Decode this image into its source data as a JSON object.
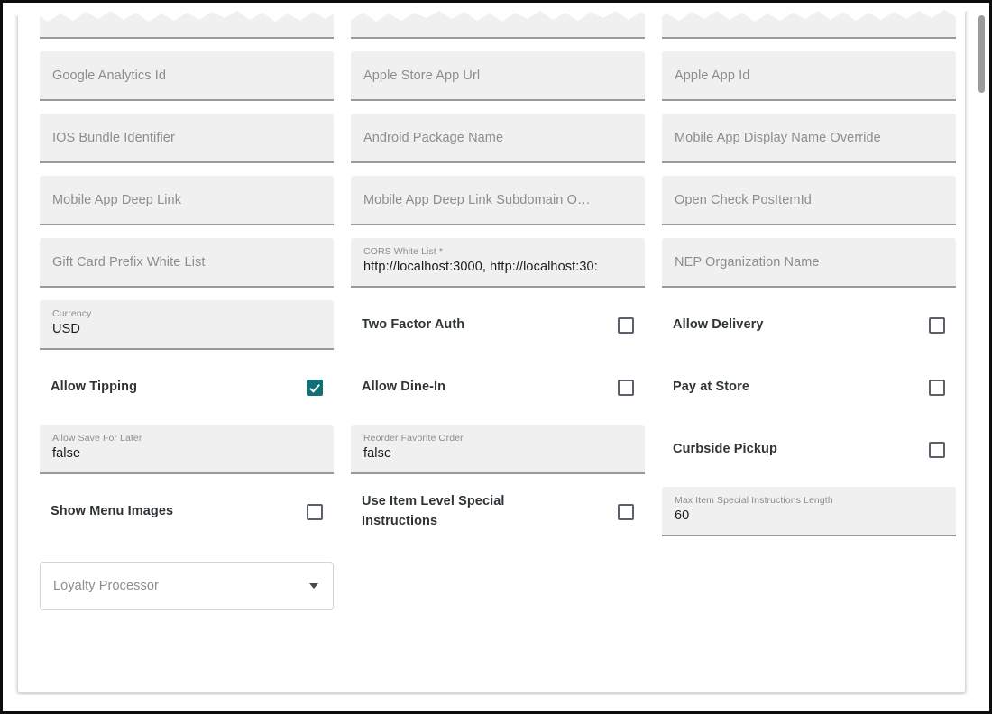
{
  "form": {
    "rows": [
      {
        "id": "row-clipped",
        "clipped": true,
        "cells": [
          {
            "type": "text-clipped",
            "name": "clipped-field-left",
            "placeholder": ""
          },
          {
            "type": "text-clipped",
            "name": "clipped-field-middle",
            "placeholder": ""
          },
          {
            "type": "text-clipped",
            "name": "clipped-field-right",
            "placeholder": ""
          }
        ]
      },
      {
        "id": "row-1",
        "cells": [
          {
            "type": "text",
            "name": "google-analytics-id-field",
            "placeholder": "Google Analytics Id",
            "value": ""
          },
          {
            "type": "text",
            "name": "apple-store-app-url-field",
            "placeholder": "Apple Store App Url",
            "value": ""
          },
          {
            "type": "text",
            "name": "apple-app-id-field",
            "placeholder": "Apple App Id",
            "value": ""
          }
        ]
      },
      {
        "id": "row-2",
        "cells": [
          {
            "type": "text",
            "name": "ios-bundle-identifier-field",
            "placeholder": "IOS Bundle Identifier",
            "value": ""
          },
          {
            "type": "text",
            "name": "android-package-name-field",
            "placeholder": "Android Package Name",
            "value": ""
          },
          {
            "type": "text",
            "name": "mobile-app-display-name-override-field",
            "placeholder": "Mobile App Display Name Override",
            "value": ""
          }
        ]
      },
      {
        "id": "row-3",
        "cells": [
          {
            "type": "text",
            "name": "mobile-app-deep-link-field",
            "placeholder": "Mobile App Deep Link",
            "value": ""
          },
          {
            "type": "text",
            "name": "mobile-app-deep-link-subdomain-override-field",
            "placeholder": "Mobile App Deep Link Subdomain O…",
            "value": ""
          },
          {
            "type": "text",
            "name": "open-check-positemid-field",
            "placeholder": "Open Check PosItemId",
            "value": ""
          }
        ]
      },
      {
        "id": "row-4",
        "cells": [
          {
            "type": "text",
            "name": "gift-card-prefix-white-list-field",
            "placeholder": "Gift Card Prefix White List",
            "value": ""
          },
          {
            "type": "filled",
            "name": "cors-white-list-field",
            "label": "CORS White List *",
            "value": "http://localhost:3000, http://localhost:30:"
          },
          {
            "type": "text",
            "name": "nep-organization-name-field",
            "placeholder": "NEP Organization Name",
            "value": ""
          }
        ]
      },
      {
        "id": "row-5",
        "cells": [
          {
            "type": "filled",
            "name": "currency-field",
            "label": "Currency",
            "value": "USD"
          },
          {
            "type": "checkbox",
            "name": "two-factor-auth-checkbox",
            "label": "Two Factor Auth",
            "checked": false
          },
          {
            "type": "checkbox",
            "name": "allow-delivery-checkbox",
            "label": "Allow Delivery",
            "checked": false
          }
        ]
      },
      {
        "id": "row-6",
        "cells": [
          {
            "type": "checkbox",
            "name": "allow-tipping-checkbox",
            "label": "Allow Tipping",
            "checked": true
          },
          {
            "type": "checkbox",
            "name": "allow-dine-in-checkbox",
            "label": "Allow Dine-In",
            "checked": false
          },
          {
            "type": "checkbox",
            "name": "pay-at-store-checkbox",
            "label": "Pay at Store",
            "checked": false
          }
        ]
      },
      {
        "id": "row-7",
        "cells": [
          {
            "type": "filled",
            "name": "allow-save-for-later-field",
            "label": "Allow Save For Later",
            "value": "false"
          },
          {
            "type": "filled",
            "name": "reorder-favorite-order-field",
            "label": "Reorder Favorite Order",
            "value": "false"
          },
          {
            "type": "checkbox",
            "name": "curbside-pickup-checkbox",
            "label": "Curbside Pickup",
            "checked": false
          }
        ]
      },
      {
        "id": "row-8",
        "cells": [
          {
            "type": "checkbox",
            "name": "show-menu-images-checkbox",
            "label": "Show Menu Images",
            "checked": false
          },
          {
            "type": "checkbox",
            "name": "use-item-level-special-instructions-checkbox",
            "label": "Use Item Level Special Instructions",
            "checked": false
          },
          {
            "type": "filled",
            "name": "max-item-special-instructions-length-field",
            "label": "Max Item Special Instructions Length",
            "value": "60"
          }
        ]
      },
      {
        "id": "row-9",
        "cells": [
          {
            "type": "select",
            "name": "loyalty-processor-select",
            "placeholder": "Loyalty Processor",
            "value": ""
          }
        ]
      }
    ]
  },
  "colors": {
    "checkbox_checked": "#0f7176",
    "field_background": "#f0f0f0",
    "field_underline": "#9a9a9a",
    "label_text": "#8d8d8d",
    "value_text": "#1c1c1c",
    "checkbox_label_text": "#2f3437",
    "card_background": "#ffffff",
    "frame_border": "#0d0d0d",
    "scrollbar_thumb": "#9b9b9b"
  },
  "scrollbar": {
    "name": "vertical-scrollbar",
    "thumb_name": "vertical-scrollbar-thumb"
  }
}
